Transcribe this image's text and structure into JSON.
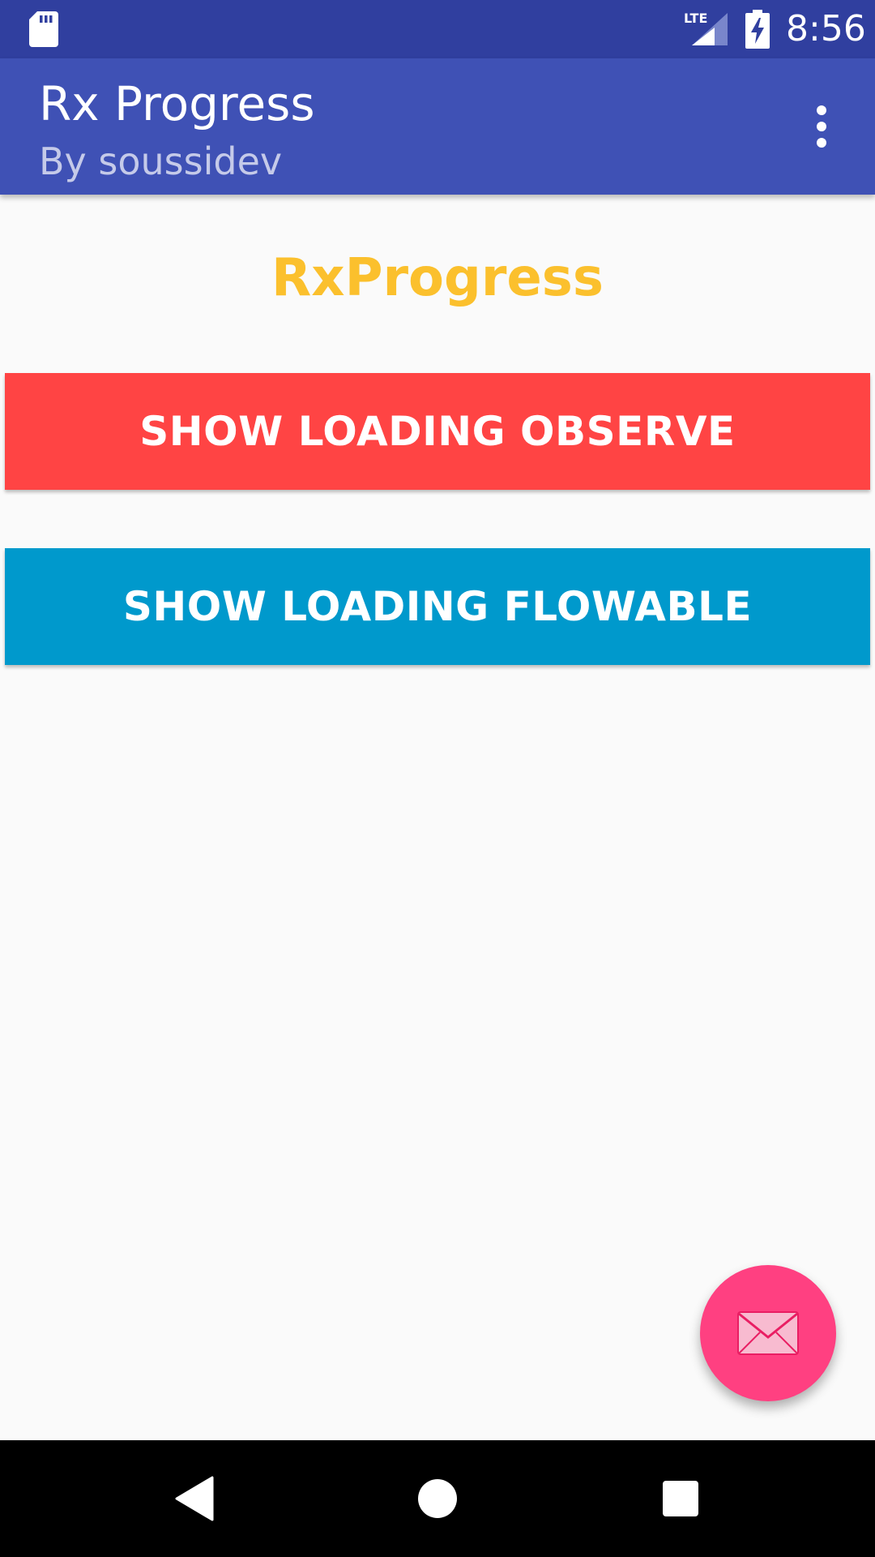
{
  "status_bar": {
    "time": "8:56",
    "network_label": "LTE",
    "icons": [
      "sd-card-icon",
      "lte-signal-icon",
      "battery-charging-icon"
    ]
  },
  "app_bar": {
    "title": "Rx Progress",
    "subtitle": "By soussidev",
    "menu_icon": "overflow-menu-icon"
  },
  "content": {
    "heading": "RxProgress",
    "buttons": [
      {
        "label": "SHOW LOADING OBSERVE",
        "color": "#ff4444"
      },
      {
        "label": "SHOW LOADING FLOWABLE",
        "color": "#0099cc"
      }
    ]
  },
  "fab": {
    "icon": "mail-icon",
    "color": "#ff4081"
  },
  "nav_bar": {
    "icons": [
      "back-icon",
      "home-icon",
      "recents-icon"
    ]
  },
  "colors": {
    "status_bar": "#303f9f",
    "app_bar": "#3f51b5",
    "heading": "#fbc02d",
    "background": "#fafafa"
  }
}
